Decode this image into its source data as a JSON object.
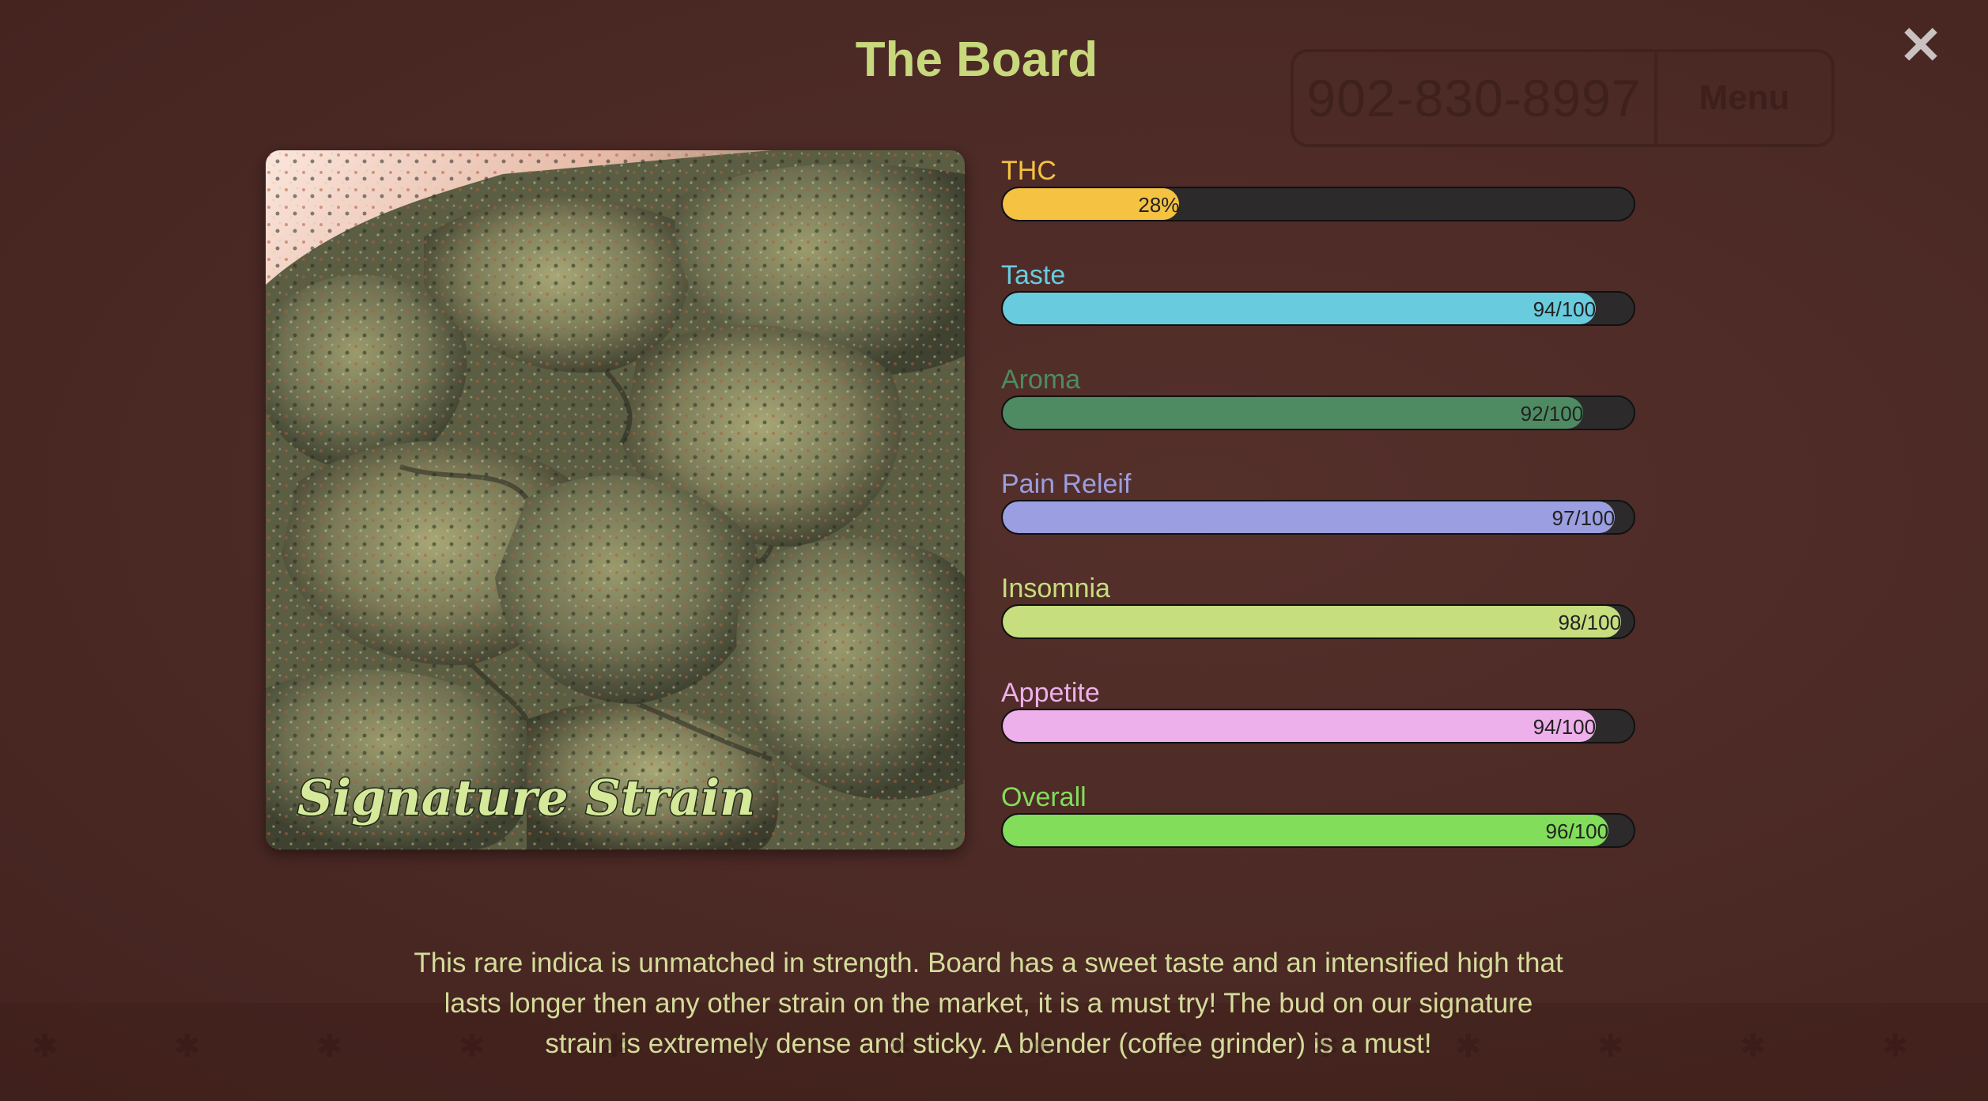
{
  "background": {
    "phone": "902-830-8997",
    "menu_label": "Menu"
  },
  "modal": {
    "title": "The Board",
    "close_icon": "close-icon",
    "image_caption": "Signature Strain",
    "description": "This rare indica is unmatched in strength. Board has a sweet taste and an intensified high that lasts longer then any other strain on the market, it is a must try! The bud on our signature strain is extremely dense and sticky. A blender (coffee grinder) is a must!"
  },
  "stats": [
    {
      "label": "THC",
      "value_text": "28%",
      "percent": 28,
      "color": "#f5c242"
    },
    {
      "label": "Taste",
      "value_text": "94/100",
      "percent": 94,
      "color": "#68ccde"
    },
    {
      "label": "Aroma",
      "value_text": "92/100",
      "percent": 92,
      "color": "#4e8b63"
    },
    {
      "label": "Pain Releif",
      "value_text": "97/100",
      "percent": 97,
      "color": "#9b9ee0"
    },
    {
      "label": "Insomnia",
      "value_text": "98/100",
      "percent": 98,
      "color": "#c6de7e"
    },
    {
      "label": "Appetite",
      "value_text": "94/100",
      "percent": 94,
      "color": "#eeb0ea"
    },
    {
      "label": "Overall",
      "value_text": "96/100",
      "percent": 96,
      "color": "#82dd5a"
    }
  ]
}
